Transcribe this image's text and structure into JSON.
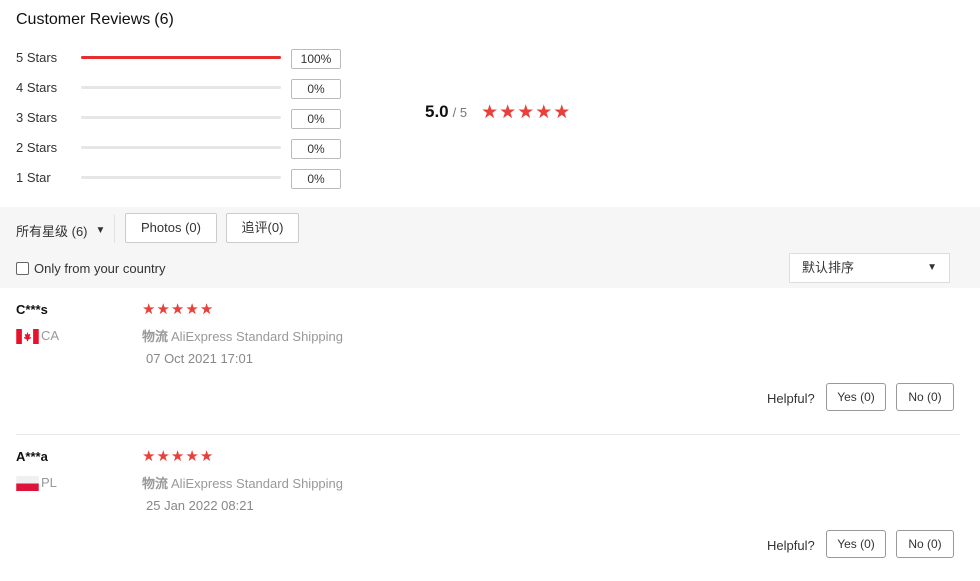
{
  "header": {
    "title": "Customer Reviews",
    "count": "(6)"
  },
  "distribution": [
    {
      "label": "5 Stars",
      "pct": "100%",
      "fraction": 1.0
    },
    {
      "label": "4 Stars",
      "pct": "0%",
      "fraction": 0
    },
    {
      "label": "3 Stars",
      "pct": "0%",
      "fraction": 0
    },
    {
      "label": "2 Stars",
      "pct": "0%",
      "fraction": 0
    },
    {
      "label": "1 Star",
      "pct": "0%",
      "fraction": 0
    }
  ],
  "average": {
    "score": "5.0",
    "out_of": "/ 5",
    "stars": 5
  },
  "filters": {
    "all_ratings": "所有星级 (6)",
    "photos": "Photos (0)",
    "follow_up": "追评(0)",
    "own_country": "Only from your country",
    "sort": "默认排序"
  },
  "reviews": [
    {
      "name": "C***s",
      "country_code": "CA",
      "flag": "canada-flag",
      "stars": 5,
      "shipping_label": "物流",
      "shipping": "AliExpress Standard Shipping",
      "date": "07 Oct 2021 17:01",
      "helpful_label": "Helpful?",
      "yes": "Yes (0)",
      "no": "No (0)"
    },
    {
      "name": "A***a",
      "country_code": "PL",
      "flag": "poland-flag",
      "stars": 5,
      "shipping_label": "物流",
      "shipping": "AliExpress Standard Shipping",
      "date": "25 Jan 2022 08:21",
      "helpful_label": "Helpful?",
      "yes": "Yes (0)",
      "no": "No (0)"
    }
  ],
  "colors": {
    "accent": "#e62e2e",
    "star": "#e8413c",
    "canada_red": "#e8112d",
    "poland_red": "#dc143c"
  }
}
